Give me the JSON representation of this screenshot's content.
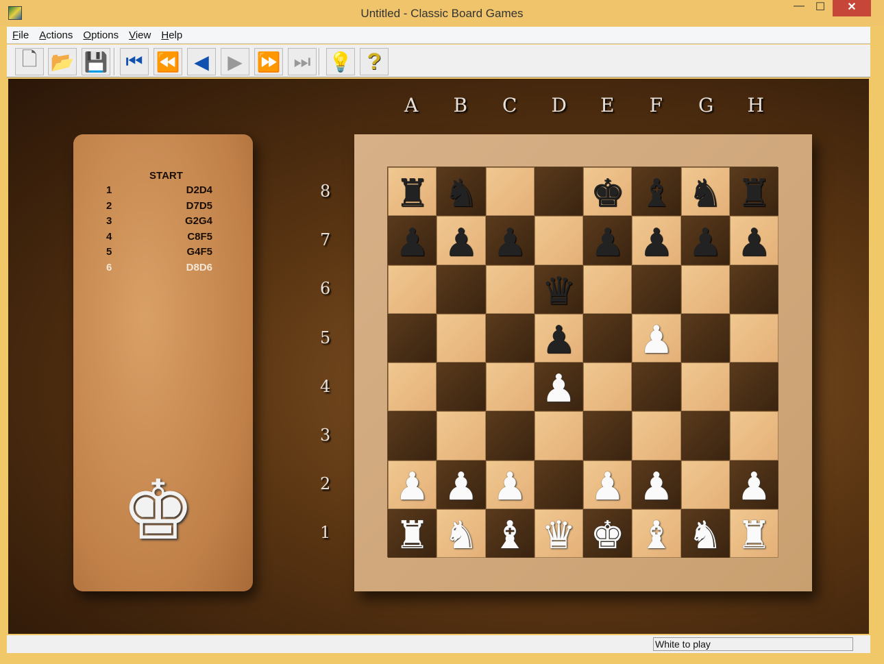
{
  "window": {
    "title": "Untitled - Classic Board Games",
    "minimize": "—",
    "maximize": "☐",
    "close": "✕"
  },
  "menu": [
    {
      "label": "File",
      "u": "F",
      "rest": "ile"
    },
    {
      "label": "Actions",
      "u": "A",
      "rest": "ctions"
    },
    {
      "label": "Options",
      "u": "O",
      "rest": "ptions"
    },
    {
      "label": "View",
      "u": "V",
      "rest": "iew"
    },
    {
      "label": "Help",
      "u": "H",
      "rest": "elp"
    }
  ],
  "toolbar": [
    {
      "name": "new-button",
      "icon": "new-document-icon",
      "glyph": "🗋",
      "color": "#555"
    },
    {
      "name": "open-button",
      "icon": "open-folder-icon",
      "glyph": "📂",
      "color": "#7a9a30"
    },
    {
      "name": "save-button",
      "icon": "floppy-disk-icon",
      "glyph": "💾",
      "color": "#333"
    },
    {
      "name": "first-move-button",
      "icon": "skip-to-start-icon",
      "glyph": "⏮",
      "color": "#1050b0"
    },
    {
      "name": "back-fast-button",
      "icon": "rewind-icon",
      "glyph": "⏪",
      "color": "#1050b0"
    },
    {
      "name": "back-button",
      "icon": "step-back-icon",
      "glyph": "◀",
      "color": "#1050b0"
    },
    {
      "name": "forward-button",
      "icon": "step-forward-icon",
      "glyph": "▶",
      "color": "#999"
    },
    {
      "name": "forward-fast-button",
      "icon": "fast-forward-icon",
      "glyph": "⏩",
      "color": "#999"
    },
    {
      "name": "last-move-button",
      "icon": "skip-to-end-icon",
      "glyph": "⏭",
      "color": "#999"
    },
    {
      "name": "hint-button",
      "icon": "lightbulb-icon",
      "glyph": "💡",
      "color": "#30b0d0"
    },
    {
      "name": "help-button",
      "icon": "question-mark-icon",
      "glyph": "?",
      "color": "#d0b020"
    }
  ],
  "moves": {
    "header": "START",
    "list": [
      {
        "n": "1",
        "move": "D2D4"
      },
      {
        "n": "2",
        "move": "D7D5"
      },
      {
        "n": "3",
        "move": "G2G4"
      },
      {
        "n": "4",
        "move": "C8F5"
      },
      {
        "n": "5",
        "move": "G4F5"
      },
      {
        "n": "6",
        "move": "D8D6",
        "current": true
      }
    ]
  },
  "turn_indicator": {
    "piece": "white-king",
    "glyph": "♚"
  },
  "board": {
    "files": [
      "A",
      "B",
      "C",
      "D",
      "E",
      "F",
      "G",
      "H"
    ],
    "ranks": [
      "8",
      "7",
      "6",
      "5",
      "4",
      "3",
      "2",
      "1"
    ],
    "position": [
      [
        "bR",
        "bN",
        "",
        "",
        "bK",
        "bB",
        "bN",
        "bR"
      ],
      [
        "bP",
        "bP",
        "bP",
        "",
        "bP",
        "bP",
        "bP",
        "bP"
      ],
      [
        "",
        "",
        "",
        "bQ",
        "",
        "",
        "",
        ""
      ],
      [
        "",
        "",
        "",
        "bP",
        "",
        "wP",
        "",
        ""
      ],
      [
        "",
        "",
        "",
        "wP",
        "",
        "",
        "",
        ""
      ],
      [
        "",
        "",
        "",
        "",
        "",
        "",
        "",
        ""
      ],
      [
        "wP",
        "wP",
        "wP",
        "",
        "wP",
        "wP",
        "",
        "wP"
      ],
      [
        "wR",
        "wN",
        "wB",
        "wQ",
        "wK",
        "wB",
        "wN",
        "wR"
      ]
    ]
  },
  "status": {
    "text": "White to play"
  }
}
